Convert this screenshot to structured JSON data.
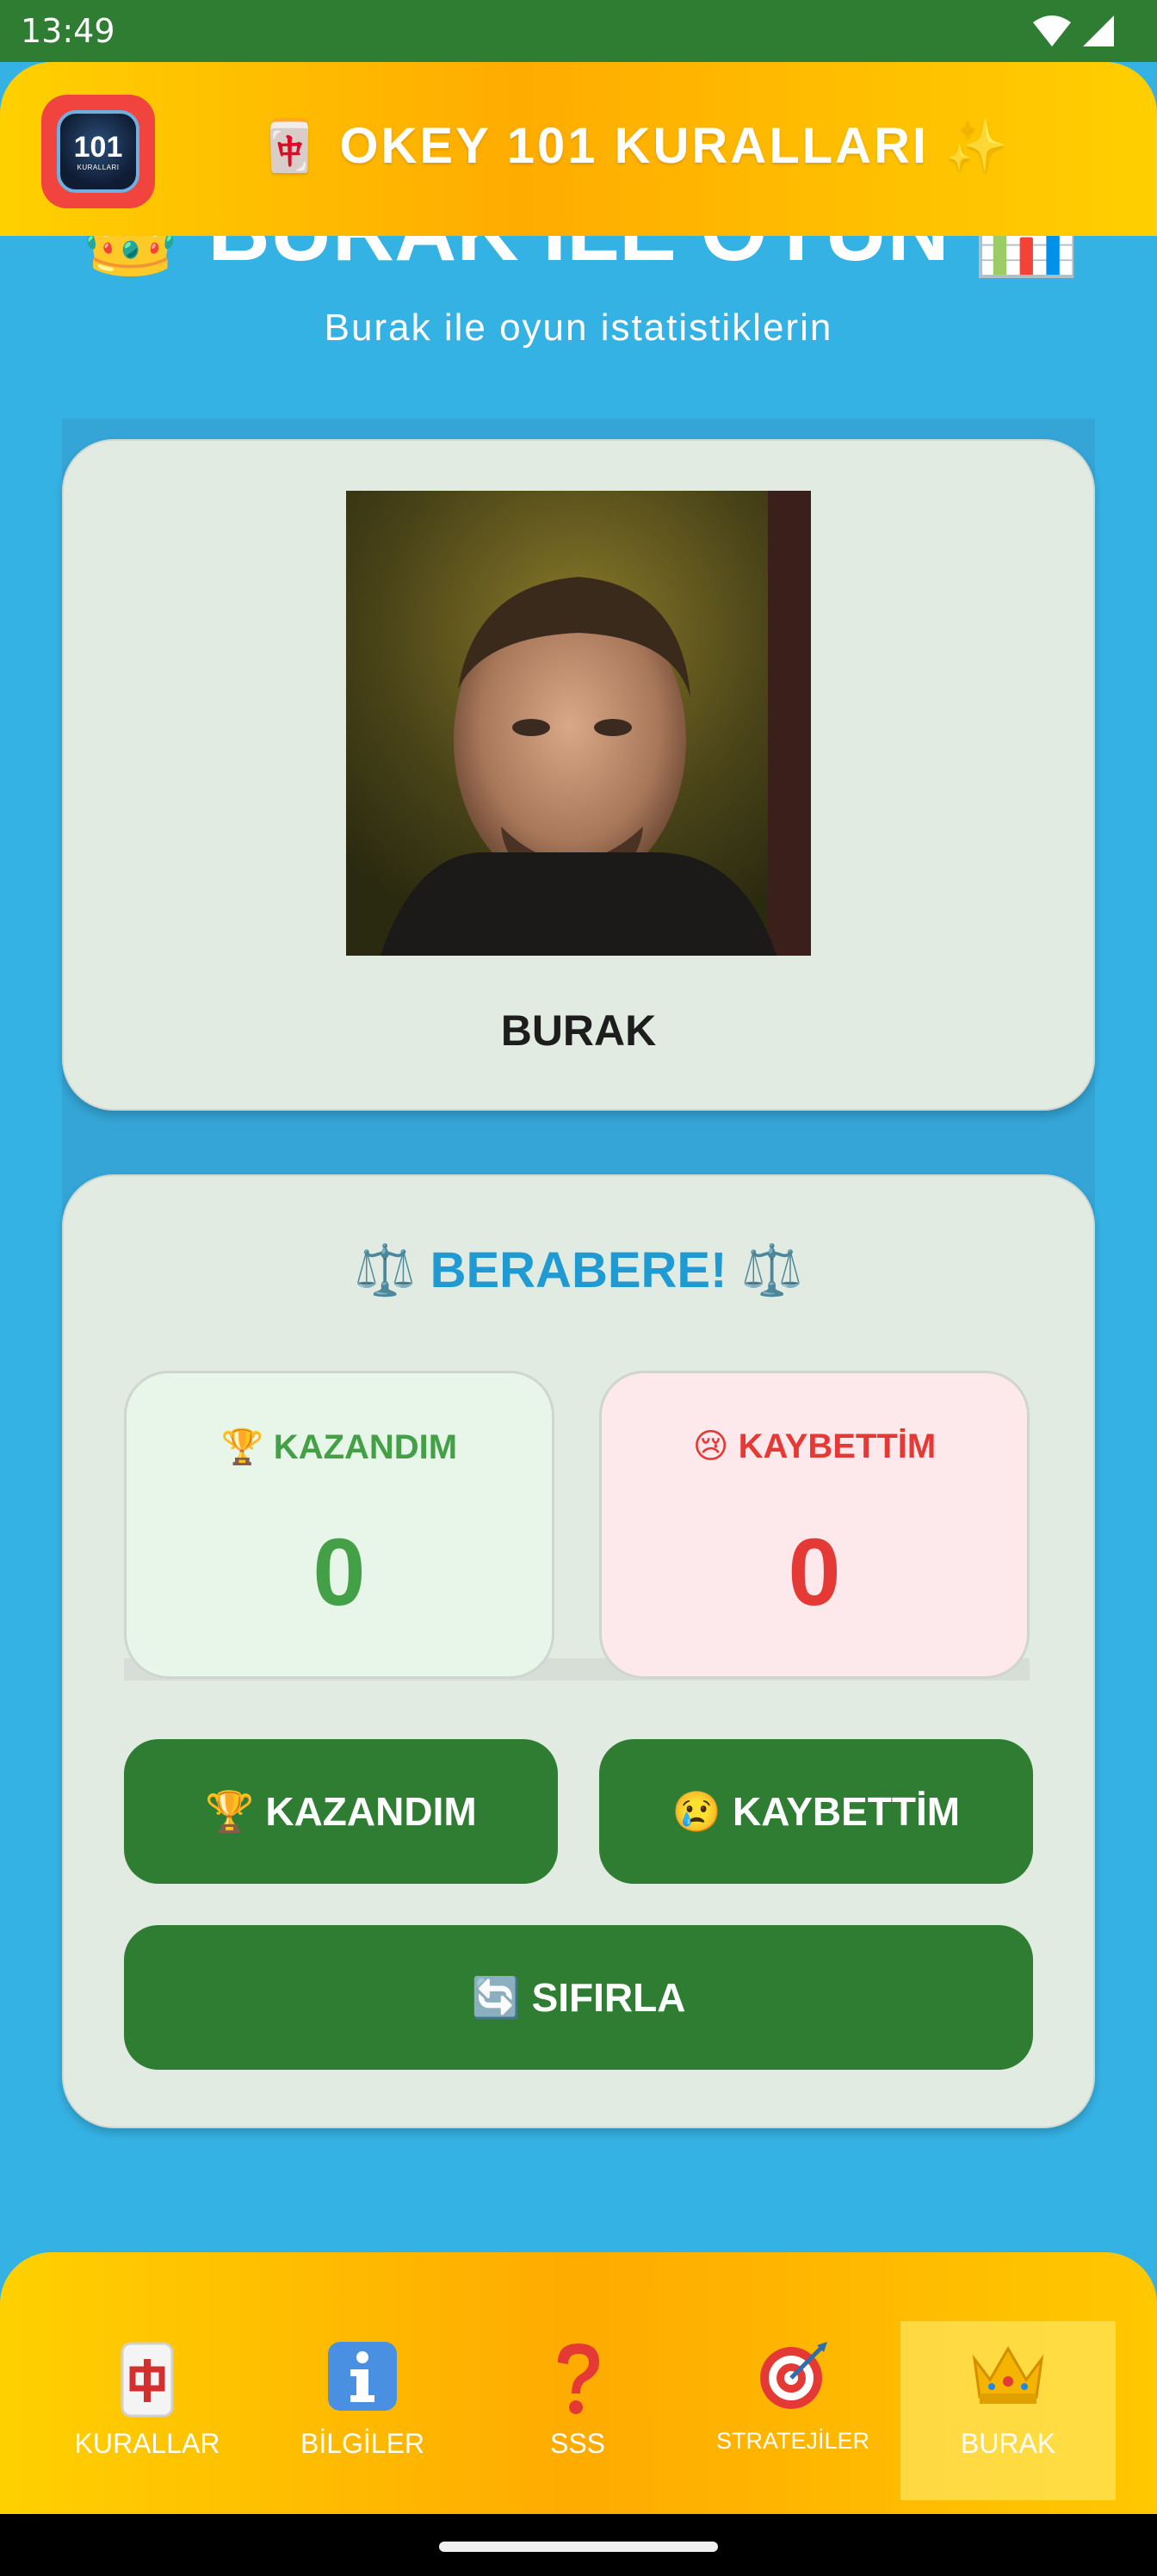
{
  "status_bar": {
    "time": "13:49"
  },
  "header": {
    "title": "🀄 OKEY 101 KURALLARI ✨",
    "app_icon_number": "101",
    "app_icon_text": "KURALLARI"
  },
  "page": {
    "heading": "👑 BURAK İLE OYUN 📊",
    "subtitle": "Burak ile oyun istatistiklerin"
  },
  "profile": {
    "name": "BURAK"
  },
  "stats": {
    "result_title": "⚖️ BERABERE! ⚖️",
    "win_label": "🏆 KAZANDIM",
    "win_value": "0",
    "lose_label": "😢 KAYBETTİM",
    "lose_value": "0"
  },
  "actions": {
    "win_button": "🏆 KAZANDIM",
    "lose_button": "😢 KAYBETTİM",
    "reset_button": "🔄 SIFIRLA"
  },
  "bottom_nav": {
    "items": [
      {
        "icon": "🀄",
        "label": "KURALLAR"
      },
      {
        "icon": "ℹ️",
        "label": "BİLGİLER"
      },
      {
        "icon": "❓",
        "label": "SSS"
      },
      {
        "icon": "🎯",
        "label": "STRATEJİLER"
      },
      {
        "icon": "👑",
        "label": "BURAK"
      }
    ],
    "active_index": 4
  },
  "colors": {
    "background": "#35b2e4",
    "primary_green": "#2e7d32",
    "header_gold": "#ffc000",
    "win_green": "#43a047",
    "lose_red": "#e53935",
    "result_blue": "#1f9ad3"
  }
}
